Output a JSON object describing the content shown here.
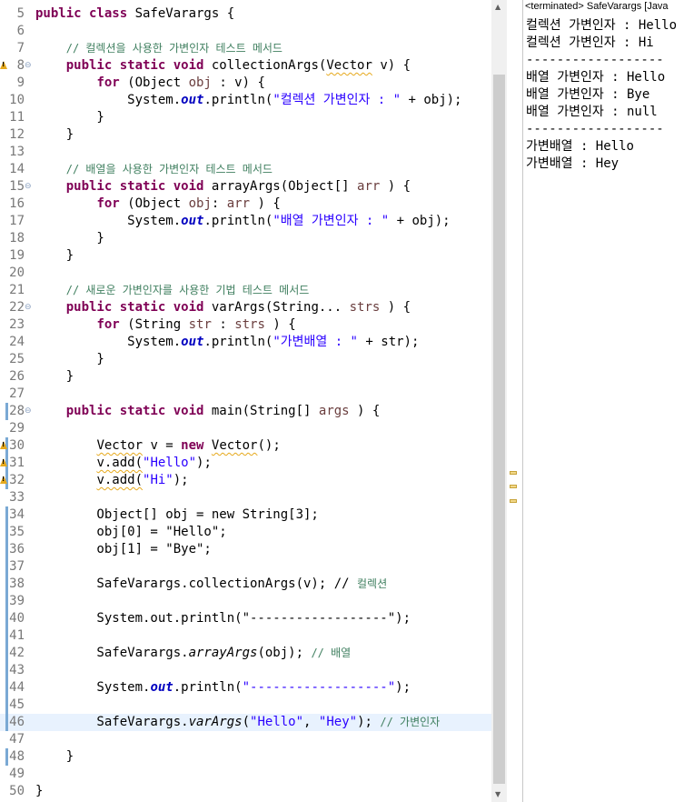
{
  "editor": {
    "lines": [
      {
        "n": "5",
        "segs": [
          [
            "kw",
            "public class "
          ],
          [
            "",
            "SafeVarargs {"
          ]
        ]
      },
      {
        "n": "6",
        "segs": []
      },
      {
        "n": "7",
        "segs": [
          [
            "",
            "    "
          ],
          [
            "cm",
            "// 컬렉션을 사용한 가변인자 테스트 메서드"
          ]
        ]
      },
      {
        "n": "8",
        "fold": "⊖",
        "segs": [
          [
            "",
            "    "
          ],
          [
            "kw",
            "public static void "
          ],
          [
            "",
            "collectionArgs("
          ],
          [
            "sq",
            "Vector"
          ],
          [
            "",
            " v) {"
          ]
        ]
      },
      {
        "n": "9",
        "segs": [
          [
            "",
            "        "
          ],
          [
            "kw",
            "for "
          ],
          [
            "",
            "(Object "
          ],
          [
            "var",
            "obj"
          ],
          [
            "",
            " : v) {"
          ]
        ]
      },
      {
        "n": "10",
        "segs": [
          [
            "",
            "            System."
          ],
          [
            "fld",
            "out"
          ],
          [
            "",
            ".println("
          ],
          [
            "str",
            "\"컬렉션 가변인자 : \""
          ],
          [
            "",
            " + obj);"
          ]
        ]
      },
      {
        "n": "11",
        "segs": [
          [
            "",
            "        }"
          ]
        ]
      },
      {
        "n": "12",
        "segs": [
          [
            "",
            "    }"
          ]
        ]
      },
      {
        "n": "13",
        "segs": []
      },
      {
        "n": "14",
        "segs": [
          [
            "",
            "    "
          ],
          [
            "cm",
            "// 배열을 사용한 가변인자 테스트 메서드"
          ]
        ]
      },
      {
        "n": "15",
        "fold": "⊖",
        "segs": [
          [
            "",
            "    "
          ],
          [
            "kw",
            "public static void "
          ],
          [
            "",
            "arrayArgs(Object[] "
          ],
          [
            "var",
            "arr"
          ],
          [
            "",
            " ) {"
          ]
        ]
      },
      {
        "n": "16",
        "segs": [
          [
            "",
            "        "
          ],
          [
            "kw",
            "for "
          ],
          [
            "",
            "(Object "
          ],
          [
            "var",
            "obj"
          ],
          [
            "",
            ": "
          ],
          [
            "var",
            "arr"
          ],
          [
            "",
            " ) {"
          ]
        ]
      },
      {
        "n": "17",
        "segs": [
          [
            "",
            "            System."
          ],
          [
            "fld",
            "out"
          ],
          [
            "",
            ".println("
          ],
          [
            "str",
            "\"배열 가변인자 : \""
          ],
          [
            "",
            " + obj);"
          ]
        ]
      },
      {
        "n": "18",
        "segs": [
          [
            "",
            "        }"
          ]
        ]
      },
      {
        "n": "19",
        "segs": [
          [
            "",
            "    }"
          ]
        ]
      },
      {
        "n": "20",
        "segs": []
      },
      {
        "n": "21",
        "segs": [
          [
            "",
            "    "
          ],
          [
            "cm",
            "// 새로운 가변인자를 사용한 기법 테스트 메서드"
          ]
        ]
      },
      {
        "n": "22",
        "fold": "⊖",
        "segs": [
          [
            "",
            "    "
          ],
          [
            "kw",
            "public static void "
          ],
          [
            "",
            "varArgs(String... "
          ],
          [
            "var",
            "strs"
          ],
          [
            "",
            " ) {"
          ]
        ]
      },
      {
        "n": "23",
        "segs": [
          [
            "",
            "        "
          ],
          [
            "kw",
            "for "
          ],
          [
            "",
            "(String "
          ],
          [
            "var",
            "str"
          ],
          [
            "",
            " : "
          ],
          [
            "var",
            "strs"
          ],
          [
            "",
            " ) {"
          ]
        ]
      },
      {
        "n": "24",
        "segs": [
          [
            "",
            "            System."
          ],
          [
            "fld",
            "out"
          ],
          [
            "",
            ".println("
          ],
          [
            "str",
            "\"가변배열 : \""
          ],
          [
            "",
            " + str);"
          ]
        ]
      },
      {
        "n": "25",
        "segs": [
          [
            "",
            "        }"
          ]
        ]
      },
      {
        "n": "26",
        "segs": [
          [
            "",
            "    }"
          ]
        ]
      },
      {
        "n": "27",
        "segs": []
      },
      {
        "n": "28",
        "fold": "⊖",
        "segs": [
          [
            "",
            "    "
          ],
          [
            "kw",
            "public static void "
          ],
          [
            "",
            "main(String[] "
          ],
          [
            "var",
            "args"
          ],
          [
            "",
            " ) {"
          ]
        ]
      },
      {
        "n": "29",
        "segs": []
      },
      {
        "n": "30",
        "segs": [
          [
            "",
            "        "
          ],
          [
            "sq",
            "Vector"
          ],
          [
            "",
            " v = "
          ],
          [
            "kw",
            "new "
          ],
          [
            "sq",
            "Vector"
          ],
          [
            "",
            "();"
          ]
        ]
      },
      {
        "n": "31",
        "segs": [
          [
            "",
            "        "
          ],
          [
            "sq",
            "v.add("
          ],
          [
            "str",
            "\"Hello\""
          ],
          [
            "",
            ");"
          ]
        ]
      },
      {
        "n": "32",
        "segs": [
          [
            "",
            "        "
          ],
          [
            "sq",
            "v.add("
          ],
          [
            "str",
            "\"Hi\""
          ],
          [
            "",
            ");"
          ]
        ]
      },
      {
        "n": "33",
        "segs": []
      },
      {
        "n": "34",
        "segs": [
          [
            "",
            "        Object[] obj = new String[3];"
          ]
        ]
      },
      {
        "n": "35",
        "segs": [
          [
            "",
            "        obj[0] = \"Hello\";"
          ]
        ]
      },
      {
        "n": "36",
        "segs": [
          [
            "",
            "        obj[1] = \"Bye\";"
          ]
        ]
      },
      {
        "n": "37",
        "segs": []
      },
      {
        "n": "38",
        "segs": [
          [
            "",
            "        SafeVarargs.collectionArgs(v); // "
          ],
          [
            "cm",
            "컬렉션"
          ]
        ]
      },
      {
        "n": "39",
        "segs": []
      },
      {
        "n": "40",
        "segs": [
          [
            "",
            "        System.out.println(\"------------------\");"
          ]
        ]
      },
      {
        "n": "41",
        "segs": []
      },
      {
        "n": "42",
        "segs": [
          [
            "",
            "        SafeVarargs."
          ],
          [
            "smc",
            "arrayArgs"
          ],
          [
            "",
            "(obj); "
          ],
          [
            "cm",
            "// 배열"
          ]
        ]
      },
      {
        "n": "43",
        "segs": []
      },
      {
        "n": "44",
        "segs": [
          [
            "",
            "        System."
          ],
          [
            "fld",
            "out"
          ],
          [
            "",
            ".println("
          ],
          [
            "str",
            "\"------------------\""
          ],
          [
            "",
            ");"
          ]
        ]
      },
      {
        "n": "45",
        "segs": []
      },
      {
        "n": "46",
        "current": true,
        "segs": [
          [
            "",
            "        SafeVarargs."
          ],
          [
            "smc",
            "varArgs"
          ],
          [
            "",
            "("
          ],
          [
            "str",
            "\"Hello\""
          ],
          [
            "",
            ", "
          ],
          [
            "str",
            "\"Hey\""
          ],
          [
            "",
            "); "
          ],
          [
            "cm",
            "// 가변인자"
          ]
        ]
      },
      {
        "n": "47",
        "segs": []
      },
      {
        "n": "48",
        "segs": [
          [
            "",
            "    }"
          ]
        ]
      },
      {
        "n": "49",
        "segs": []
      },
      {
        "n": "50",
        "segs": [
          [
            "",
            "}"
          ]
        ]
      }
    ],
    "scroll_up": "▲",
    "scroll_down": "▼"
  },
  "console": {
    "title": "<terminated> SafeVarargs [Java",
    "lines": [
      "컬렉션 가변인자 : Hello",
      "컬렉션 가변인자 : Hi",
      "------------------",
      "배열 가변인자 : Hello",
      "배열 가변인자 : Bye",
      "배열 가변인자 : null",
      "------------------",
      "가변배열 : Hello",
      "가변배열 : Hey"
    ]
  },
  "colors": {
    "keyword": "#7f0055",
    "comment": "#3f7f5f",
    "string": "#2a00ff",
    "field": "#0000c0",
    "current_line": "#e8f2fe",
    "warning": "#e6a91d"
  }
}
